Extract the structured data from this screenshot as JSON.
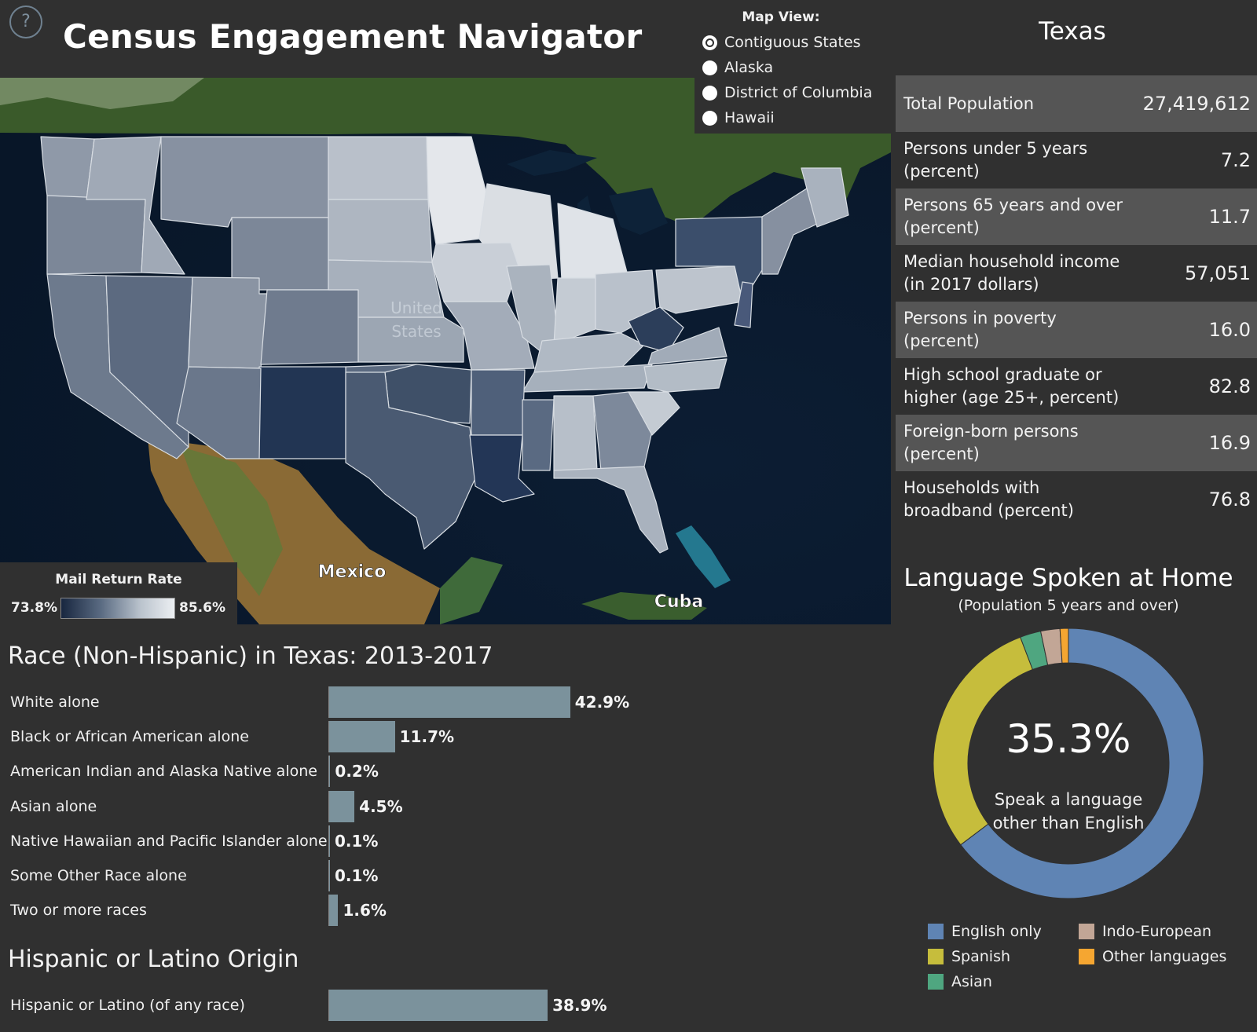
{
  "header": {
    "help_icon": "question-circle-icon",
    "help_glyph": "?",
    "title": "Census Engagement Navigator"
  },
  "map_view": {
    "title": "Map View:",
    "options": [
      {
        "label": "Contiguous States",
        "selected": true
      },
      {
        "label": "Alaska",
        "selected": false
      },
      {
        "label": "District of Columbia",
        "selected": false
      },
      {
        "label": "Hawaii",
        "selected": false
      }
    ]
  },
  "map": {
    "labels": {
      "country_us": "United States",
      "mexico": "Mexico",
      "cuba": "Cuba"
    },
    "legend": {
      "title": "Mail Return Rate",
      "min": "73.8%",
      "max": "85.6%",
      "color_low": "#18263f",
      "color_high": "#eceff2"
    }
  },
  "state": {
    "name": "Texas",
    "facts": [
      {
        "label": "Total Population",
        "value": "27,419,612"
      },
      {
        "label": "Persons under 5 years (percent)",
        "value": "7.2"
      },
      {
        "label": "Persons 65 years and over (percent)",
        "value": "11.7"
      },
      {
        "label": "Median household income (in 2017 dollars)",
        "value": "57,051"
      },
      {
        "label": "Persons in poverty (percent)",
        "value": "16.0"
      },
      {
        "label": "High school graduate or higher (age 25+, percent)",
        "value": "82.8"
      },
      {
        "label": "Foreign-born persons (percent)",
        "value": "16.9"
      },
      {
        "label": "Households with broadband (percent)",
        "value": "76.8"
      }
    ]
  },
  "race": {
    "title": "Race (Non-Hispanic) in Texas: 2013-2017",
    "bar_color": "#7b929c"
  },
  "hispanic": {
    "title": "Hispanic or Latino Origin"
  },
  "language": {
    "title": "Language Spoken at Home",
    "subtitle": "(Population 5 years and over)",
    "center_value": "35.3%",
    "center_caption_line1": "Speak a language",
    "center_caption_line2": "other than English"
  },
  "chart_data": [
    {
      "type": "bar",
      "title": "Race (Non-Hispanic) in Texas: 2013-2017",
      "orientation": "horizontal",
      "categories": [
        "White alone",
        "Black or African American alone",
        "American Indian and Alaska Native alone",
        "Asian alone",
        "Native Hawaiian and Pacific Islander alone",
        "Some Other Race alone",
        "Two or more races"
      ],
      "values": [
        42.9,
        11.7,
        0.2,
        4.5,
        0.1,
        0.1,
        1.6
      ],
      "value_labels": [
        "42.9%",
        "11.7%",
        "0.2%",
        "4.5%",
        "0.1%",
        "0.1%",
        "1.6%"
      ],
      "unit": "%"
    },
    {
      "type": "bar",
      "title": "Hispanic or Latino Origin",
      "orientation": "horizontal",
      "categories": [
        "Hispanic or Latino (of any race)"
      ],
      "values": [
        38.9
      ],
      "value_labels": [
        "38.9%"
      ],
      "unit": "%"
    },
    {
      "type": "pie",
      "title": "Language Spoken at Home",
      "donut": true,
      "categories": [
        "English only",
        "Spanish",
        "Asian",
        "Indo-European",
        "Other languages"
      ],
      "values": [
        64.7,
        29.5,
        2.5,
        2.3,
        1.0
      ],
      "colors": [
        "#5f84b4",
        "#c6bd3c",
        "#4fa680",
        "#c2a696",
        "#f5a631"
      ]
    }
  ]
}
